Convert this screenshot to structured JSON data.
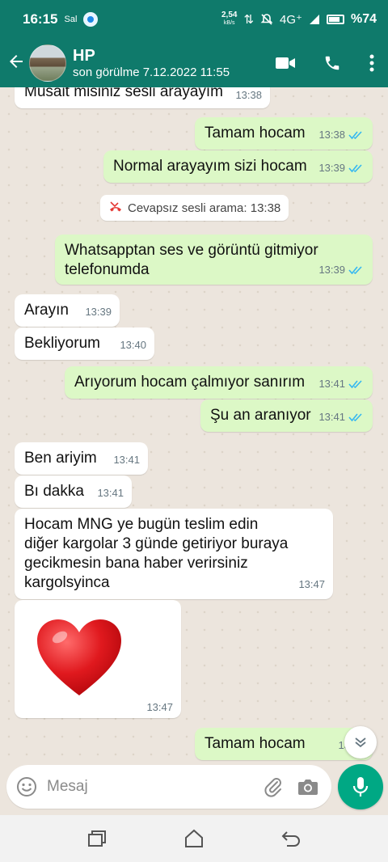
{
  "status_bar": {
    "time": "16:15",
    "day": "Sal",
    "speed_value": "2,54",
    "speed_unit": "kB/s",
    "network": "4G⁺",
    "battery": "%74"
  },
  "header": {
    "name": "HP",
    "last_seen": "son görülme 7.12.2022 11:55"
  },
  "messages": [
    {
      "dir": "in",
      "text": "Müsait misiniz sesli arayayım",
      "time": "13:38"
    },
    {
      "dir": "out",
      "text": "Tamam hocam",
      "time": "13:38"
    },
    {
      "dir": "out",
      "text": "Normal arayayım sizi hocam",
      "time": "13:39"
    },
    {
      "dir": "system",
      "text": "Cevapsız sesli arama: 13:38"
    },
    {
      "dir": "out",
      "text": "Whatsapptan ses ve görüntü gitmiyor",
      "text2": "telefonumda",
      "time": "13:39"
    },
    {
      "dir": "in",
      "text": "Arayın",
      "time": "13:39"
    },
    {
      "dir": "in",
      "text": "Bekliyorum",
      "time": "13:40"
    },
    {
      "dir": "out",
      "text": "Arıyorum hocam çalmıyor sanırım",
      "time": "13:41"
    },
    {
      "dir": "out",
      "text": "Şu an aranıyor",
      "time": "13:41"
    },
    {
      "dir": "in",
      "text": "Ben ariyim",
      "time": "13:41"
    },
    {
      "dir": "in",
      "text": "Bı dakka",
      "time": "13:41"
    },
    {
      "dir": "in",
      "lines": [
        "Hocam MNG ye bugün teslim edin",
        "diğer kargolar 3 günde getiriyor buraya",
        "gecikmesin bana haber verirsiniz",
        "kargolsyinca"
      ],
      "time": "13:47"
    },
    {
      "dir": "in",
      "sticker": "red-heart",
      "time": "13:47"
    },
    {
      "dir": "out",
      "text": "Tamam hocam",
      "time": "13:48"
    }
  ],
  "composer": {
    "placeholder": "Mesaj"
  },
  "colors": {
    "header": "#0f7a6b",
    "outgoing_bubble": "#dcf8c6",
    "incoming_bubble": "#ffffff",
    "read_ticks": "#34b7f1",
    "mic_button": "#00a884",
    "missed_call": "#e53935"
  }
}
